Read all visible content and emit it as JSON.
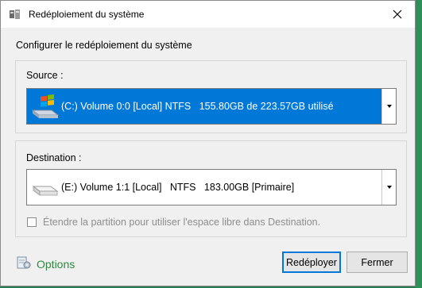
{
  "window": {
    "title": "Redéploiement du système",
    "heading": "Configurer le redéploiement du système"
  },
  "source": {
    "label": "Source :",
    "selected": "(C:) Volume 0:0 [Local] NTFS   155.80GB de 223.57GB utilisé",
    "icon": "windows-drive-icon"
  },
  "destination": {
    "label": "Destination :",
    "selected": "(E:) Volume 1:1 [Local]   NTFS   183.00GB [Primaire]",
    "icon": "hard-drive-icon",
    "extend_checkbox_label": "Étendre la partition pour utiliser l'espace libre dans Destination.",
    "extend_checked": false
  },
  "footer": {
    "options_label": "Options",
    "redeploy_label": "Redéployer",
    "close_label": "Fermer"
  },
  "colors": {
    "accent": "#0078d7",
    "options_text": "#2e8a3e",
    "background_desktop": "#2c7a4f"
  }
}
